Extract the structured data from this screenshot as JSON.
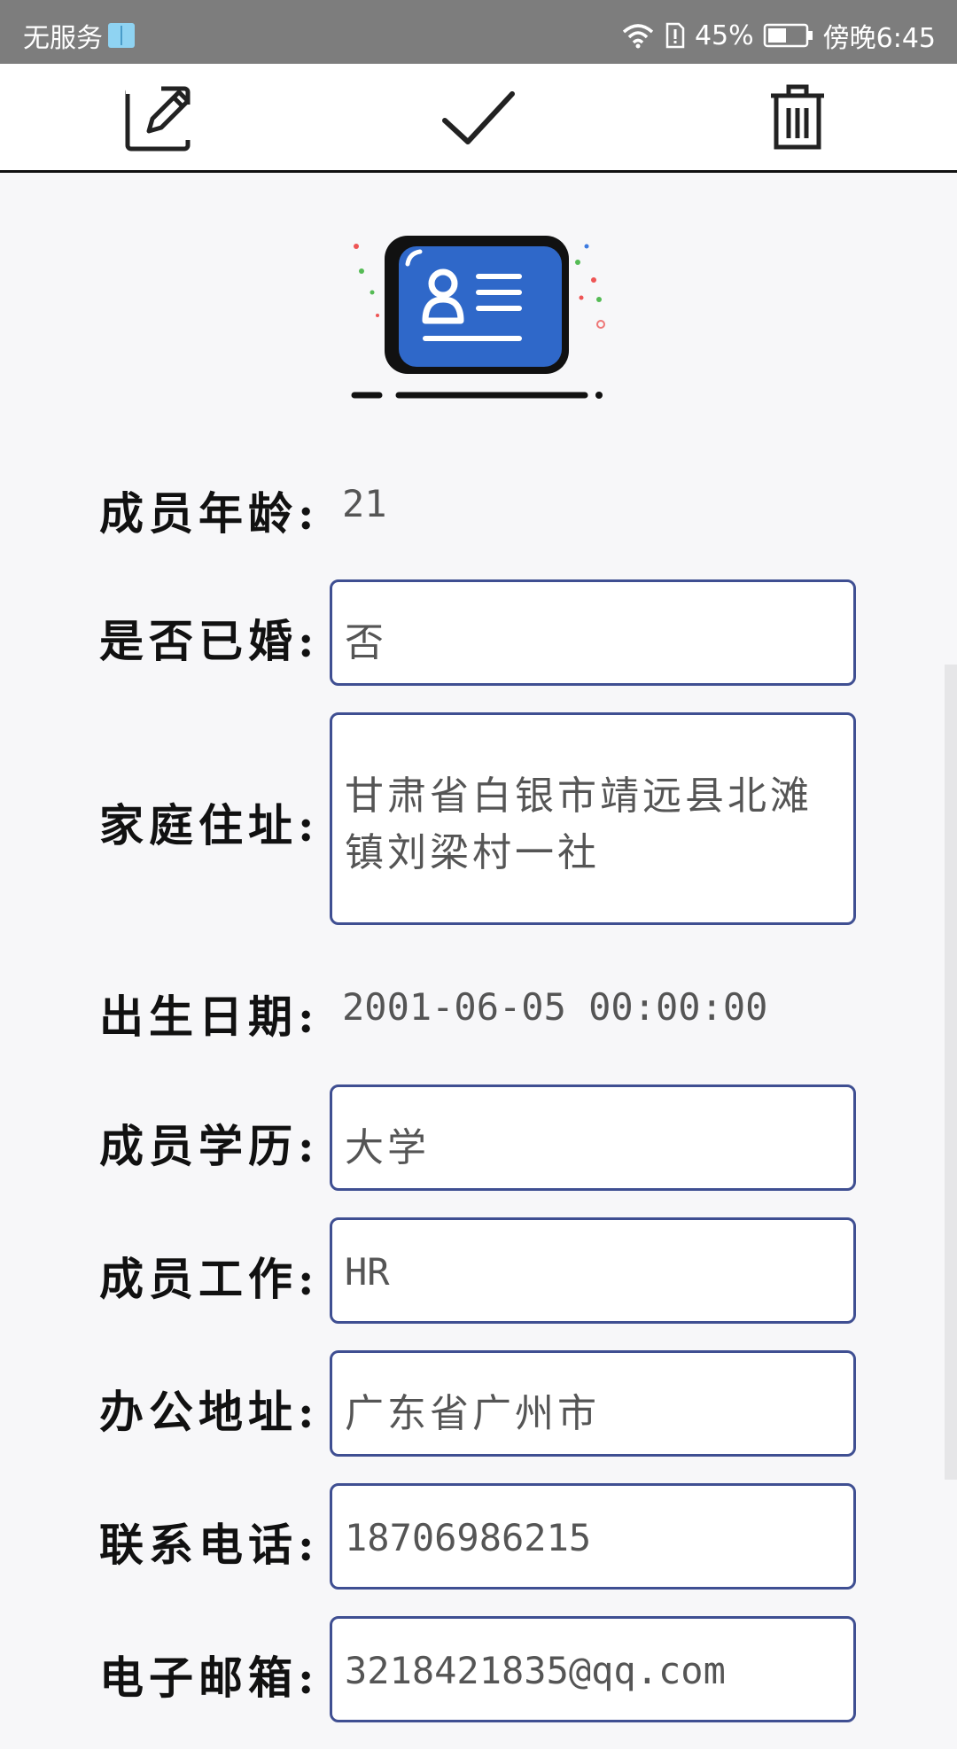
{
  "status_bar": {
    "carrier": "无服务",
    "battery_percent": "45%",
    "time": "傍晚6:45",
    "icons": [
      "book-icon",
      "wifi-icon",
      "sim-alert-icon",
      "battery-icon"
    ]
  },
  "toolbar": {
    "icons": [
      "edit-icon",
      "check-icon",
      "trash-icon"
    ]
  },
  "hero": {
    "icon": "id-card-icon",
    "accent_color": "#2f68c9"
  },
  "form": {
    "age": {
      "label": "成员年龄:",
      "value": "21"
    },
    "married": {
      "label": "是否已婚:",
      "value": "否"
    },
    "address": {
      "label": "家庭住址:",
      "value": "甘肃省白银市靖远县北滩镇刘梁村一社"
    },
    "birth": {
      "label": "出生日期:",
      "value": "2001-06-05 00:00:00"
    },
    "education": {
      "label": "成员学历:",
      "value": "大学"
    },
    "job": {
      "label": "成员工作:",
      "value": "HR"
    },
    "office": {
      "label": "办公地址:",
      "value": "广东省广州市"
    },
    "phone": {
      "label": "联系电话:",
      "value": "18706986215"
    },
    "email": {
      "label": "电子邮箱:",
      "value": "3218421835@qq.com"
    }
  },
  "colors": {
    "field_border": "#3f4f92",
    "status_bar": "#7d7d7d"
  }
}
